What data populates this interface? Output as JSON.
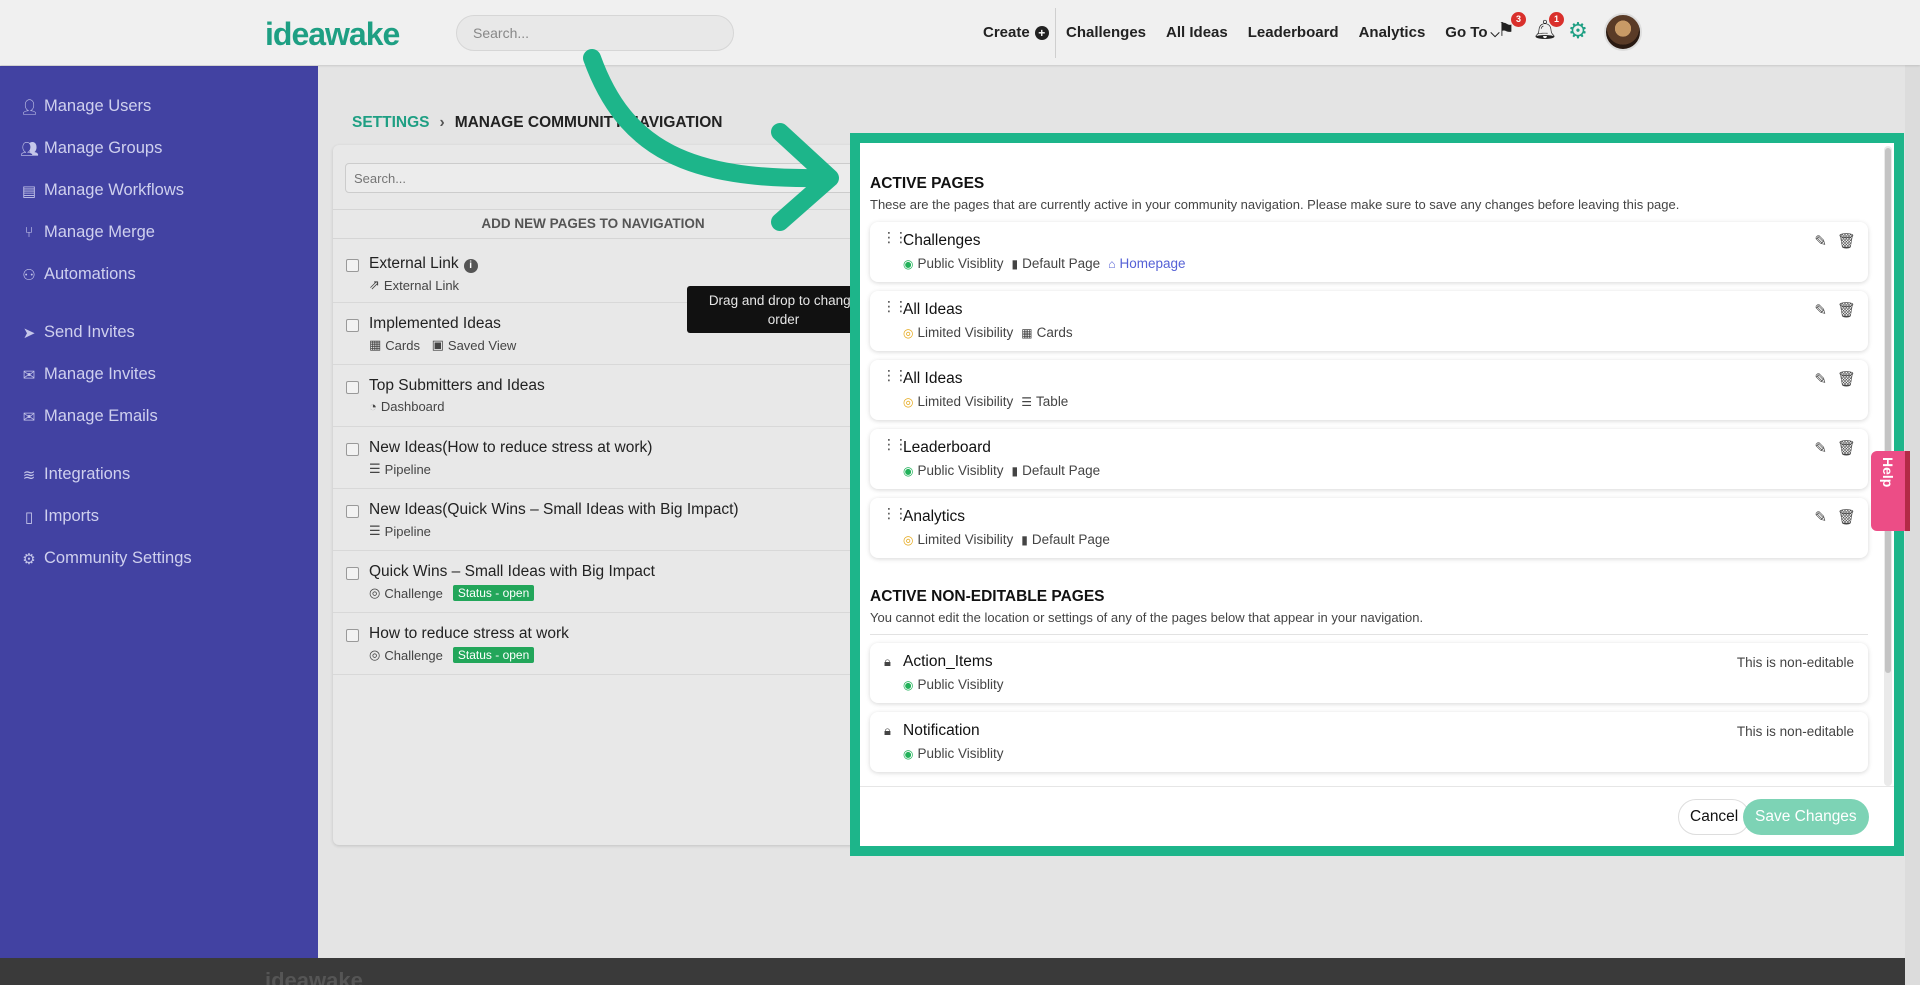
{
  "header": {
    "logo": "ideawake",
    "search_placeholder": "Search...",
    "create_label": "Create",
    "nav": [
      "Challenges",
      "All Ideas",
      "Leaderboard",
      "Analytics",
      "Go To"
    ],
    "flag_count": "3",
    "bell_count": "1"
  },
  "sidebar": {
    "items": [
      {
        "label": "Manage Users",
        "icon": "user-icon"
      },
      {
        "label": "Manage Groups",
        "icon": "users-icon"
      },
      {
        "label": "Manage Workflows",
        "icon": "workflow-icon"
      },
      {
        "label": "Manage Merge",
        "icon": "merge-icon"
      },
      {
        "label": "Automations",
        "icon": "robot-icon"
      },
      {
        "label": "Send Invites",
        "icon": "paper-plane-icon"
      },
      {
        "label": "Manage Invites",
        "icon": "invites-icon"
      },
      {
        "label": "Manage Emails",
        "icon": "envelope-icon"
      },
      {
        "label": "Integrations",
        "icon": "database-icon"
      },
      {
        "label": "Imports",
        "icon": "file-icon"
      },
      {
        "label": "Community Settings",
        "icon": "gears-icon"
      }
    ]
  },
  "breadcrumb": {
    "root": "SETTINGS",
    "current": "MANAGE COMMUNITY NAVIGATION"
  },
  "add_panel": {
    "search_placeholder": "Search...",
    "heading": "ADD NEW PAGES TO NAVIGATION",
    "rows": [
      {
        "title": "External Link",
        "sub": [
          "External Link"
        ]
      },
      {
        "title": "Implemented Ideas",
        "sub": [
          "Cards",
          "Saved View"
        ]
      },
      {
        "title": "Top Submitters and Ideas",
        "sub": [
          "Dashboard"
        ]
      },
      {
        "title": "New Ideas(How to reduce stress at work)",
        "sub": [
          "Pipeline"
        ]
      },
      {
        "title": "New Ideas(Quick Wins – Small Ideas with Big Impact)",
        "sub": [
          "Pipeline"
        ]
      },
      {
        "title": "Quick Wins – Small Ideas with Big Impact",
        "sub": [
          "Challenge"
        ],
        "status": "Status - open"
      },
      {
        "title": "How to reduce stress at work",
        "sub": [
          "Challenge"
        ],
        "status": "Status - open"
      }
    ]
  },
  "tooltip": "Drag and drop to change order",
  "modal": {
    "active_title": "ACTIVE PAGES",
    "active_desc": "These are the pages that are currently active in your community navigation. Please make sure to save any changes before leaving this page.",
    "active_pages": [
      {
        "title": "Challenges",
        "visibility": "Public Visiblity",
        "vis_type": "public",
        "meta": [
          "Default Page"
        ],
        "link": "Homepage"
      },
      {
        "title": "All Ideas",
        "visibility": "Limited Visibility",
        "vis_type": "limited",
        "meta": [
          "Cards"
        ]
      },
      {
        "title": "All Ideas",
        "visibility": "Limited Visibility",
        "vis_type": "limited",
        "meta": [
          "Table"
        ]
      },
      {
        "title": "Leaderboard",
        "visibility": "Public Visiblity",
        "vis_type": "public",
        "meta": [
          "Default Page"
        ]
      },
      {
        "title": "Analytics",
        "visibility": "Limited Visibility",
        "vis_type": "limited",
        "meta": [
          "Default Page"
        ]
      }
    ],
    "noneditable_title": "ACTIVE NON-EDITABLE PAGES",
    "noneditable_desc": "You cannot edit the location or settings of any of the pages below that appear in your navigation.",
    "noneditable_pages": [
      {
        "title": "Action_Items",
        "visibility": "Public Visiblity",
        "note": "This is non-editable"
      },
      {
        "title": "Notification",
        "visibility": "Public Visiblity",
        "note": "This is non-editable"
      }
    ],
    "cancel_label": "Cancel",
    "save_label": "Save Changes"
  },
  "help_label": "Help",
  "colors": {
    "accent": "#1db58a",
    "sidebar": "#4242a2",
    "save_button": "#7dd3b5",
    "status_badge": "#22a65a"
  }
}
